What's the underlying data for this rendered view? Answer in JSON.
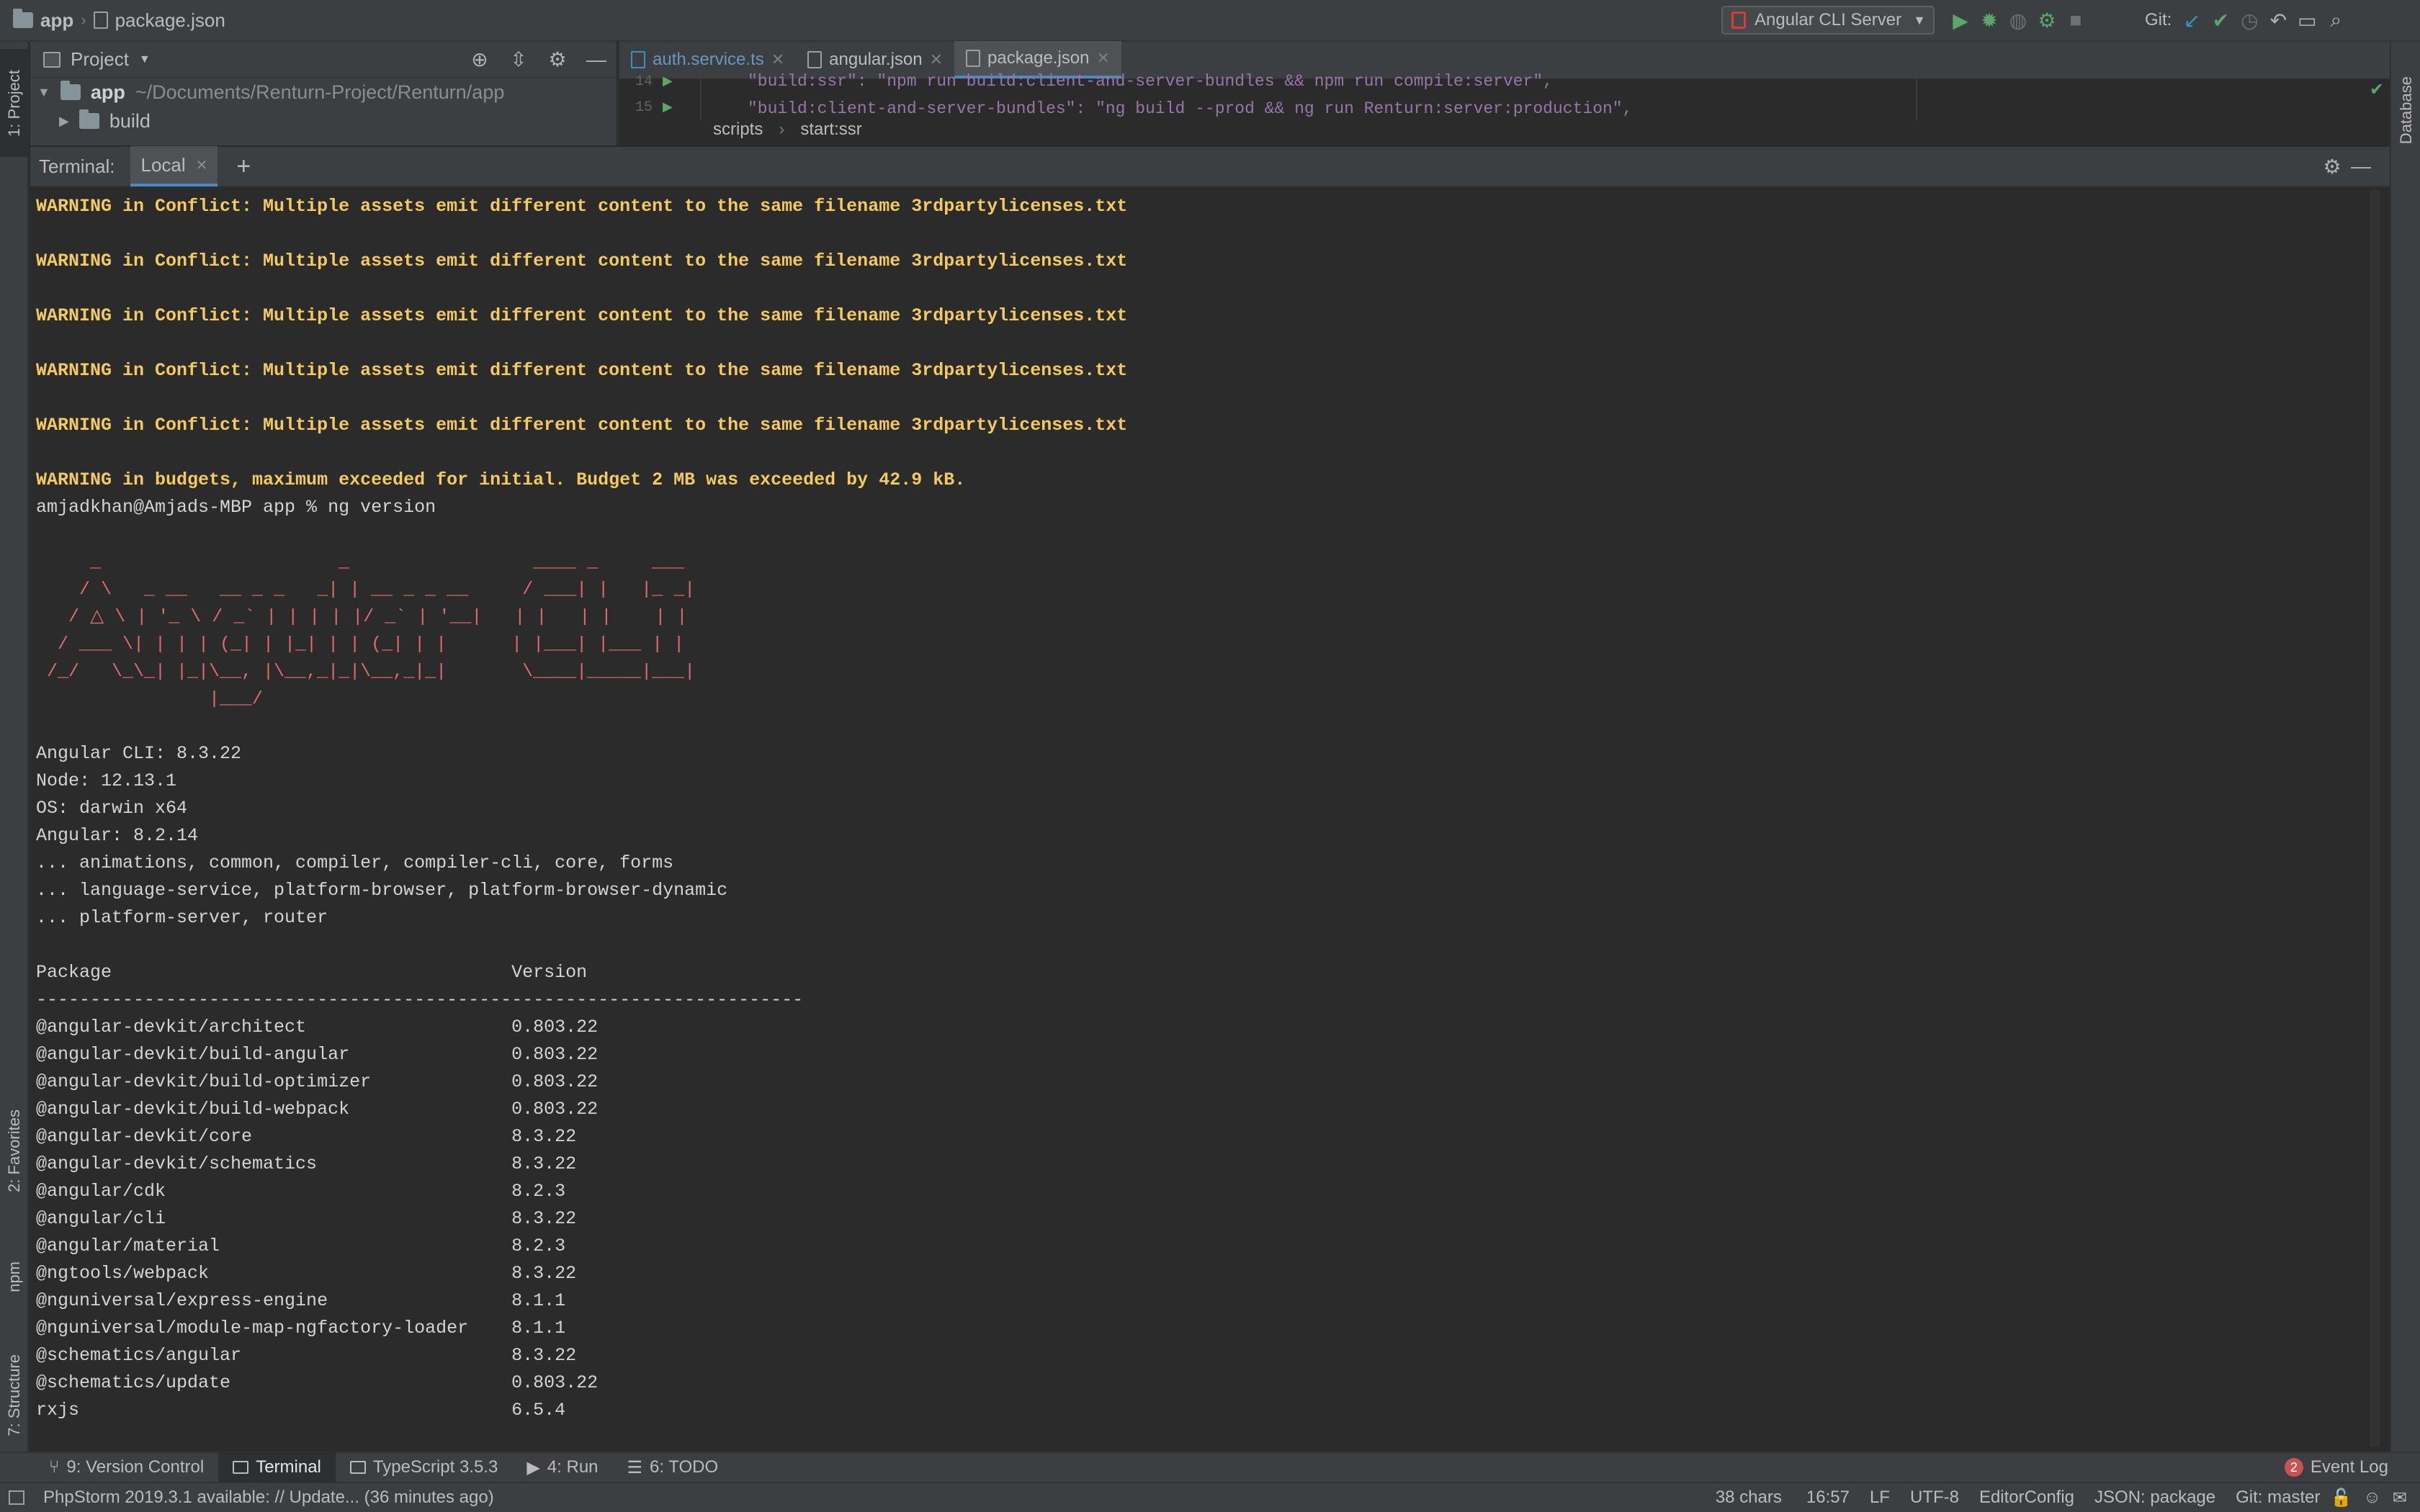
{
  "nav": {
    "crumb1": "app",
    "crumb2": "package.json"
  },
  "toolbar": {
    "run_config": "Angular CLI Server",
    "git_label": "Git:"
  },
  "left_stripe": {
    "project": "1: Project",
    "favorites": "2: Favorites",
    "npm": "npm",
    "structure": "7: Structure"
  },
  "right_stripe": {
    "database": "Database"
  },
  "project": {
    "title": "Project",
    "root_name": "app",
    "root_path": "~/Documents/Renturn-Project/Renturn/app",
    "child": "build"
  },
  "editor": {
    "tabs": [
      {
        "label": "auth.service.ts"
      },
      {
        "label": "angular.json"
      },
      {
        "label": "package.json"
      }
    ],
    "line14_no": "14",
    "line14": "\"build:ssr\": \"npm run build:client-and-server-bundles && npm run compile:server\",",
    "line15_no": "15",
    "line15": "\"build:client-and-server-bundles\": \"ng build --prod && ng run Renturn:server:production\",",
    "breadcrumb": [
      "scripts",
      "start:ssr"
    ]
  },
  "terminal": {
    "label": "Terminal:",
    "tab": "Local",
    "warning": "WARNING in Conflict: Multiple assets emit different content to the same filename 3rdpartylicenses.txt",
    "budget": "WARNING in budgets, maximum exceeded for initial. Budget 2 MB was exceeded by 42.9 kB.",
    "prompt": "amjadkhan@Amjads-MBP app % ng version",
    "ascii": [
      "     _                      _                 ____ _     ___",
      "    / \\   _ __   __ _ _   _| | __ _ _ __     / ___| |   |_ _|",
      "   / △ \\ | '_ \\ / _` | | | | |/ _` | '__|   | |   | |    | |",
      "  / ___ \\| | | | (_| | |_| | | (_| | |      | |___| |___ | |",
      " /_/   \\_\\_| |_|\\__, |\\__,_|_|\\__,_|_|       \\____|_____|___|",
      "                |___/"
    ],
    "info": [
      "Angular CLI: 8.3.22",
      "Node: 12.13.1",
      "OS: darwin x64",
      "Angular: 8.2.14",
      "... animations, common, compiler, compiler-cli, core, forms",
      "... language-service, platform-browser, platform-browser-dynamic",
      "... platform-server, router"
    ],
    "table_header": "Package                                     Version",
    "table_rule": "-----------------------------------------------------------------------",
    "packages": [
      "@angular-devkit/architect                   0.803.22",
      "@angular-devkit/build-angular               0.803.22",
      "@angular-devkit/build-optimizer             0.803.22",
      "@angular-devkit/build-webpack               0.803.22",
      "@angular-devkit/core                        8.3.22",
      "@angular-devkit/schematics                  8.3.22",
      "@angular/cdk                                8.2.3",
      "@angular/cli                                8.3.22",
      "@angular/material                           8.2.3",
      "@ngtools/webpack                            8.3.22",
      "@nguniversal/express-engine                 8.1.1",
      "@nguniversal/module-map-ngfactory-loader    8.1.1",
      "@schematics/angular                         8.3.22",
      "@schematics/update                          0.803.22",
      "rxjs                                        6.5.4"
    ]
  },
  "bottom_tabs": {
    "vc": "9: Version Control",
    "terminal": "Terminal",
    "ts": "TypeScript 3.5.3",
    "run": "4: Run",
    "todo": "6: TODO",
    "event_count": "2",
    "event_log": "Event Log"
  },
  "status": {
    "message": "PhpStorm 2019.3.1 available: // Update... (36 minutes ago)",
    "chars": "38 chars",
    "pos": "16:57",
    "lf": "LF",
    "enc": "UTF-8",
    "editorconfig": "EditorConfig",
    "schema": "JSON: package",
    "git": "Git: master"
  }
}
